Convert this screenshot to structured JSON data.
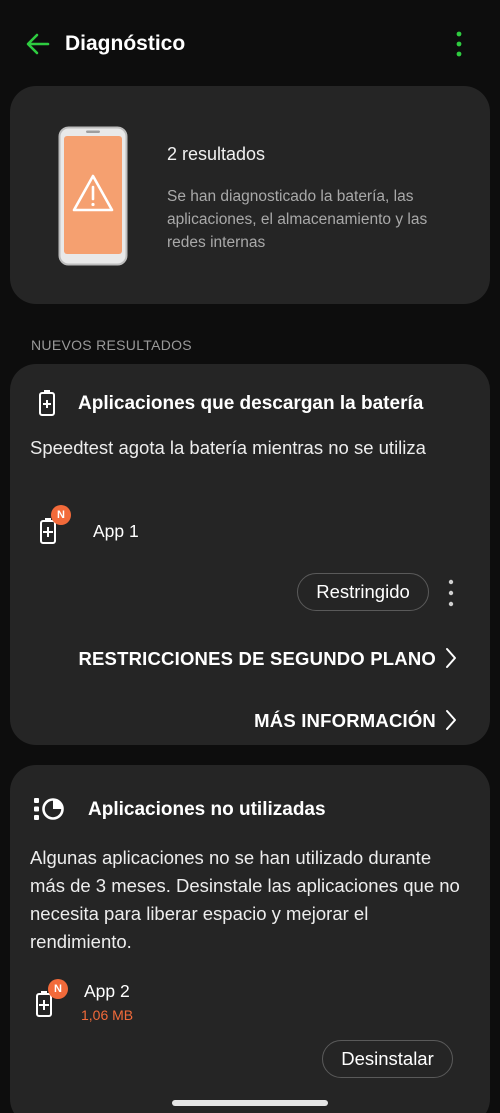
{
  "appbar": {
    "title": "Diagnóstico",
    "accent_color": "#2ecc40",
    "back_icon": "arrow-left-icon",
    "more_icon": "more-vert-icon"
  },
  "summary": {
    "count": "2 resultados",
    "description": "Se han diagnosticado la batería, las aplicaciones, el almacenamiento y las redes internas",
    "illustration": "phone-warning-icon",
    "warning_color": "#f5a070"
  },
  "section_label": "NUEVOS RESULTADOS",
  "battery_card": {
    "icon": "battery-plus-icon",
    "title": "Aplicaciones que descargan la batería",
    "body": "Speedtest agota la batería mientras no se utiliza",
    "app": {
      "name": "App 1",
      "badge": "N",
      "icon": "battery-plus-icon"
    },
    "restrict_label": "Restringido",
    "background_link": "RESTRICCIONES DE SEGUNDO PLANO",
    "more_info_link": "MÁS INFORMACIÓN"
  },
  "unused_card": {
    "icon": "unused-apps-icon",
    "title": "Aplicaciones no utilizadas",
    "body": "Algunas aplicaciones no se han utilizado durante más de 3 meses. Desinstale las aplicaciones que no necesita para liberar espacio y mejorar el rendimiento.",
    "app": {
      "name": "App 2",
      "size": "1,06 MB",
      "badge": "N",
      "icon": "battery-plus-icon"
    },
    "uninstall_label": "Desinstalar"
  },
  "badge_color": "#f26a3a"
}
